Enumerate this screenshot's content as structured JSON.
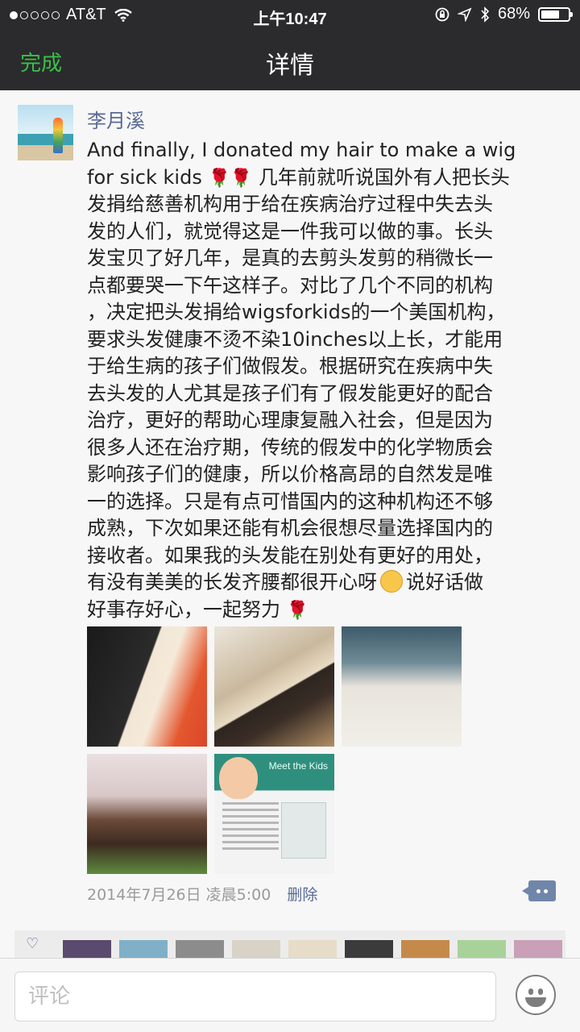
{
  "status_bar": {
    "carrier": "AT&T",
    "time": "上午10:47",
    "battery": "68%",
    "battery_level": 0.68
  },
  "nav": {
    "done_label": "完成",
    "title": "详情"
  },
  "post": {
    "author": "李月溪",
    "lines": [
      {
        "text": "And finally, I donated my hair to make a wig",
        "roses": 0
      },
      {
        "text": "for sick kids",
        "roses": 2,
        "after": " 几年前就听说国外有人把长头"
      },
      {
        "text": "发捐给慈善机构用于给在疾病治疗过程中失去头",
        "roses": 0
      },
      {
        "text": "发的人们，就觉得这是一件我可以做的事。长头",
        "roses": 0
      },
      {
        "text": "发宝贝了好几年，是真的去剪头发剪的稍微长一",
        "roses": 0
      },
      {
        "text": "点都要哭一下午这样子。对比了几个不同的机构",
        "roses": 0
      },
      {
        "text": "，决定把头发捐给wigsforkids的一个美国机构，",
        "roses": 0
      },
      {
        "text": "要求头发健康不烫不染10inches以上长，才能用",
        "roses": 0
      },
      {
        "text": "于给生病的孩子们做假发。根据研究在疾病中失",
        "roses": 0
      },
      {
        "text": "去头发的人尤其是孩子们有了假发能更好的配合",
        "roses": 0
      },
      {
        "text": "治疗，更好的帮助心理康复融入社会，但是因为",
        "roses": 0
      },
      {
        "text": "很多人还在治疗期，传统的假发中的化学物质会",
        "roses": 0
      },
      {
        "text": "影响孩子们的健康，所以价格高昂的自然发是唯",
        "roses": 0
      },
      {
        "text": "一的选择。只是有点可惜国内的这种机构还不够",
        "roses": 0
      },
      {
        "text": "成熟，下次如果还能有机会很想尽量选择国内的",
        "roses": 0
      },
      {
        "text": "接收者。如果我的头发能在别处有更好的用处，",
        "roses": 0
      },
      {
        "text": "有没有美美的长发齐腰都很开心呀",
        "emoji": true,
        "after": "说好话做"
      },
      {
        "text": "好事存好心，一起努力",
        "roses": 1
      }
    ],
    "photo_5_caption": "Meet the Kids",
    "date": "2014年7月26日 凌晨5:00",
    "delete_label": "删除"
  },
  "comment_bar": {
    "placeholder": "评论"
  },
  "icons": {
    "rose": "rose-emoji-icon",
    "grin": "grin-emoji-icon",
    "comment": "comment-icon",
    "emoji_button": "smiley-icon"
  },
  "colors": {
    "nav_bg": "#2b2b2d",
    "done_green": "#3bc04a",
    "name_blue": "#586b95"
  }
}
